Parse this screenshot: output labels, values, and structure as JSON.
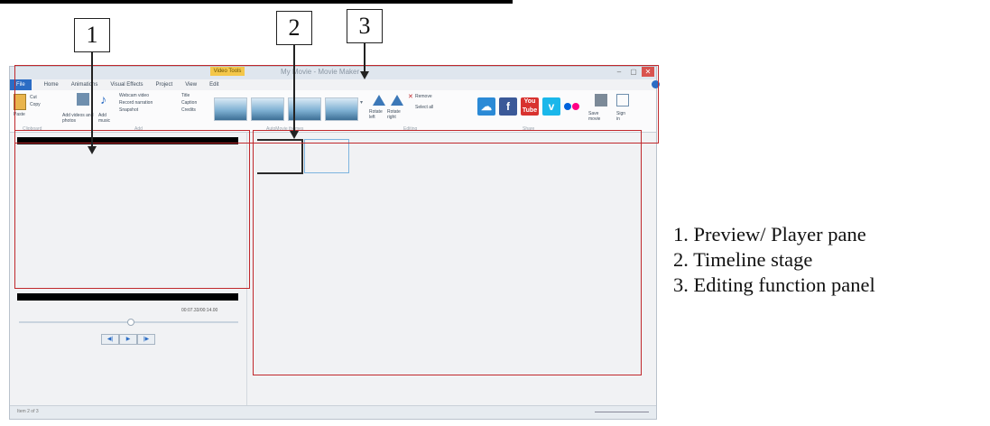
{
  "callouts": [
    "1",
    "2",
    "3"
  ],
  "legend": [
    "1. Preview/ Player pane",
    "2. Timeline stage",
    "3. Editing function panel"
  ],
  "app": {
    "title": "My Movie - Movie Maker",
    "contextual_tab": "Video Tools",
    "tabs": [
      "File",
      "Home",
      "Animations",
      "Visual Effects",
      "Project",
      "View",
      "Edit"
    ],
    "groups": [
      "Clipboard",
      "Add",
      "AutoMovie themes",
      "Editing",
      "Share"
    ],
    "clipboard": {
      "paste": "Paste",
      "cut": "Cut",
      "copy": "Copy"
    },
    "add": {
      "add_videos": "Add videos and photos",
      "add_music": "Add music",
      "webcam": "Webcam video",
      "record_narration": "Record narration",
      "snapshot": "Snapshot",
      "title": "Title",
      "caption": "Caption",
      "credits": "Credits"
    },
    "editing": {
      "rotate_left": "Rotate left",
      "rotate_right": "Rotate right",
      "remove": "Remove",
      "select_all": "Select all"
    },
    "share": {
      "save_movie": "Save movie",
      "sign_in": "Sign in"
    },
    "player": {
      "time": "00:07.33/00:14.00"
    },
    "status": {
      "left": "Item 2 of 3"
    }
  }
}
